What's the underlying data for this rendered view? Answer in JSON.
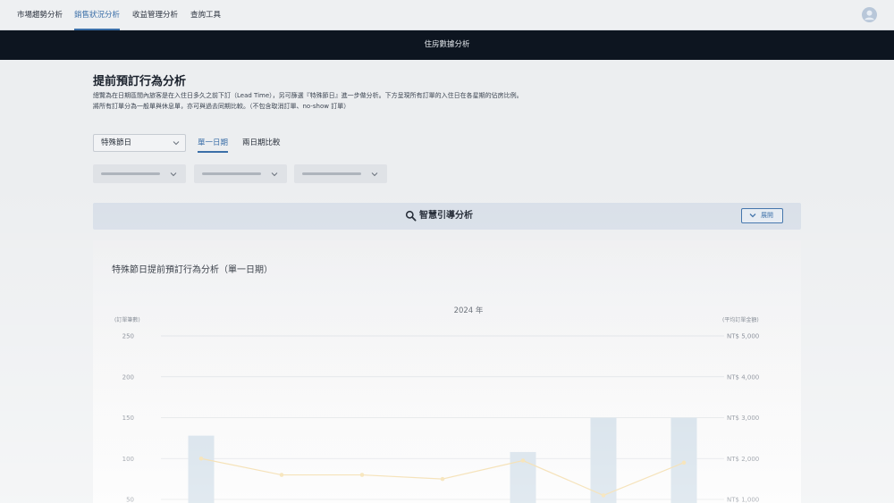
{
  "nav": {
    "tabs": [
      {
        "label": "市場趨勢分析",
        "active": false
      },
      {
        "label": "銷售狀況分析",
        "active": true
      },
      {
        "label": "收益管理分析",
        "active": false
      },
      {
        "label": "查詢工具",
        "active": false
      }
    ],
    "avatar_icon": "user-avatar-icon"
  },
  "banner": {
    "label": "住房數據分析"
  },
  "page": {
    "title": "提前預訂行為分析",
    "desc_lines": [
      "總覽為在日期區間內旅客是在入住日多久之前下訂（Lead Time），另可篩選『特殊節日』進一步做分析。下方呈現所有訂單的入住日在各星期的佔房比例。",
      "將所有訂單分為一般單與休息單，亦可與過去同期比較。（不包含取消訂單、no-show 訂單）"
    ]
  },
  "controls": {
    "select_value": "特殊節日",
    "mode_tabs": [
      {
        "label": "單一日期",
        "active": true
      },
      {
        "label": "兩日期比較",
        "active": false
      }
    ]
  },
  "guide": {
    "label": "智慧引導分析",
    "expand_label": "展開",
    "icon": "search-icon"
  },
  "card": {
    "title": "特殊節日提前預訂行為分析（單一日期）"
  },
  "colors": {
    "accent": "#3b6fa8",
    "bar": "#c9d8e4",
    "line": "#efcf8a",
    "banner_bg": "#0d1520"
  },
  "chart_data": {
    "type": "bar",
    "title": "2024 年",
    "left_axis_label": "(訂單筆數)",
    "right_axis_label": "(平均訂單金額)",
    "left_ticks": [
      "250",
      "200",
      "150",
      "100",
      "50"
    ],
    "right_ticks": [
      "NT$ 5,000",
      "NT$ 4,000",
      "NT$ 3,000",
      "NT$ 2,000",
      "NT$ 1,000"
    ],
    "ylim_left": [
      50,
      250
    ],
    "ylim_right": [
      1000,
      5000
    ],
    "slots": 7,
    "series": [
      {
        "type": "bar",
        "axis": "left",
        "values": [
          128,
          null,
          null,
          null,
          108,
          150,
          150
        ]
      },
      {
        "type": "line",
        "axis": "right",
        "values": [
          2000,
          1600,
          1600,
          1500,
          1950,
          1100,
          1900
        ]
      }
    ]
  }
}
